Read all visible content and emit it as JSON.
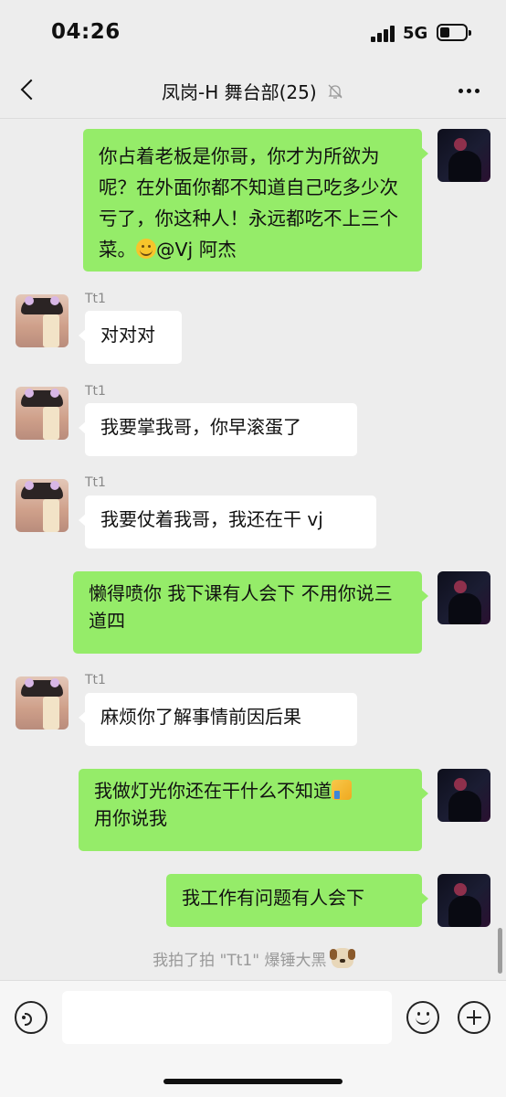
{
  "status_bar": {
    "time": "04:26",
    "network": "5G"
  },
  "nav": {
    "title": "凤岗-H 舞台部(25)",
    "back_icon": "chevron-left-icon",
    "mute_icon": "bell-slash-icon",
    "more_icon": "ellipsis-icon"
  },
  "messages": [
    {
      "side": "me",
      "text": "你占着老板是你哥，你才为所欲为呢？在外面你都不知道自己吃多少次亏了，你这种人！永远都吃不上三个菜。",
      "emoji": "smile-emoji",
      "mention": "@Vj 阿杰"
    },
    {
      "side": "other",
      "sender": "Tt1",
      "text": "对对对"
    },
    {
      "side": "other",
      "sender": "Tt1",
      "text": "我要掌我哥，你早滚蛋了"
    },
    {
      "side": "other",
      "sender": "Tt1",
      "text": "我要仗着我哥，我还在干 vj"
    },
    {
      "side": "me",
      "text": "懒得喷你 我下课有人会下 不用你说三道四"
    },
    {
      "side": "other",
      "sender": "Tt1",
      "text": "麻烦你了解事情前因后果"
    },
    {
      "side": "me",
      "text_line1": "我做灯光你还在干什么不知道",
      "emoji": "thumbs-up-emoji",
      "text_line2": "用你说我"
    },
    {
      "side": "me",
      "text": "我工作有问题有人会下"
    }
  ],
  "system": {
    "text": "我拍了拍 \"Tt1\" 爆锤大黑",
    "emoji": "dog-emoji"
  },
  "input_bar": {
    "voice_icon": "voice-icon",
    "emoji_icon": "emoji-icon",
    "plus_icon": "plus-icon"
  }
}
